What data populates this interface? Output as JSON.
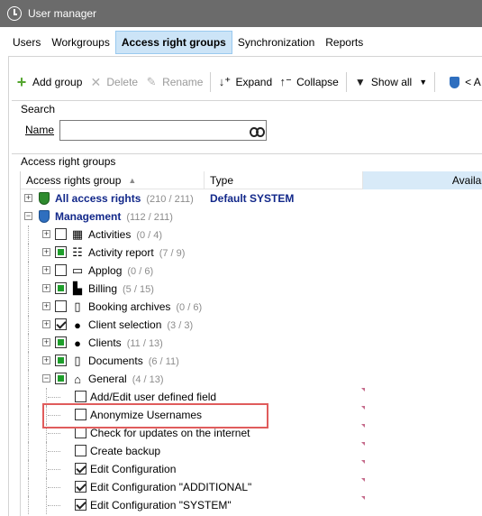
{
  "window": {
    "title": "User manager"
  },
  "menu": {
    "tabs": [
      {
        "label": "Users",
        "active": false
      },
      {
        "label": "Workgroups",
        "active": false
      },
      {
        "label": "Access right groups",
        "active": true
      },
      {
        "label": "Synchronization",
        "active": false
      },
      {
        "label": "Reports",
        "active": false
      }
    ]
  },
  "toolbar": {
    "add_group": "Add group",
    "delete": "Delete",
    "rename": "Rename",
    "expand": "Expand",
    "collapse": "Collapse",
    "show_all": "Show all",
    "truncated": "< A"
  },
  "search": {
    "group_label": "Search",
    "name_label": "Name",
    "name_value": "",
    "name_placeholder": ""
  },
  "grid": {
    "group_label": "Access right groups",
    "columns": [
      "Access rights group",
      "Type",
      "Availab"
    ],
    "rows": [
      {
        "level": 0,
        "expander": "+",
        "icon": "green-shield-icon",
        "label": "All access rights",
        "count": "(210 / 211)",
        "type": "Default SYSTEM",
        "bold": true
      },
      {
        "level": 0,
        "expander": "-",
        "icon": "blue-shield-icon",
        "label": "Management",
        "count": "(112 / 211)",
        "type": "",
        "bold": true
      },
      {
        "level": 1,
        "expander": "+",
        "checkbox": "empty",
        "icon": "grid-icon",
        "label": "Activities",
        "count": "(0 / 4)"
      },
      {
        "level": 1,
        "expander": "+",
        "checkbox": "partial",
        "icon": "activity-report-icon",
        "label": "Activity report",
        "count": "(7 / 9)"
      },
      {
        "level": 1,
        "expander": "+",
        "checkbox": "empty",
        "icon": "applog-icon",
        "label": "Applog",
        "count": "(0 / 6)"
      },
      {
        "level": 1,
        "expander": "+",
        "checkbox": "partial",
        "icon": "billing-icon",
        "label": "Billing",
        "count": "(5 / 15)"
      },
      {
        "level": 1,
        "expander": "+",
        "checkbox": "empty",
        "icon": "booking-archive-icon",
        "label": "Booking archives",
        "count": "(0 / 6)"
      },
      {
        "level": 1,
        "expander": "+",
        "checkbox": "checked",
        "icon": "client-selection-icon",
        "label": "Client selection",
        "count": "(3 / 3)"
      },
      {
        "level": 1,
        "expander": "+",
        "checkbox": "partial",
        "icon": "clients-icon",
        "label": "Clients",
        "count": "(11 / 13)"
      },
      {
        "level": 1,
        "expander": "+",
        "checkbox": "partial",
        "icon": "documents-icon",
        "label": "Documents",
        "count": "(6 / 11)"
      },
      {
        "level": 1,
        "expander": "-",
        "checkbox": "partial",
        "icon": "home-icon",
        "label": "General",
        "count": "(4 / 13)"
      },
      {
        "level": 2,
        "checkbox": "empty",
        "label": "Add/Edit user defined field",
        "marker": true
      },
      {
        "level": 2,
        "checkbox": "empty",
        "label": "Anonymize Usernames",
        "marker": true
      },
      {
        "level": 2,
        "checkbox": "empty",
        "label": "Check for updates on the internet",
        "marker": true
      },
      {
        "level": 2,
        "checkbox": "empty",
        "label": "Create backup",
        "marker": true
      },
      {
        "level": 2,
        "checkbox": "checked",
        "label": "Edit Configuration",
        "marker": true
      },
      {
        "level": 2,
        "checkbox": "checked",
        "label": "Edit Configuration \"ADDITIONAL\"",
        "marker": true
      },
      {
        "level": 2,
        "checkbox": "checked",
        "label": "Edit Configuration \"SYSTEM\"",
        "marker": true
      }
    ]
  },
  "colors": {
    "highlight_box": "#e05c5c",
    "active_tab": "#cce4f7",
    "bold_text": "#12288a",
    "partial_fill": "#1e9e2b"
  }
}
